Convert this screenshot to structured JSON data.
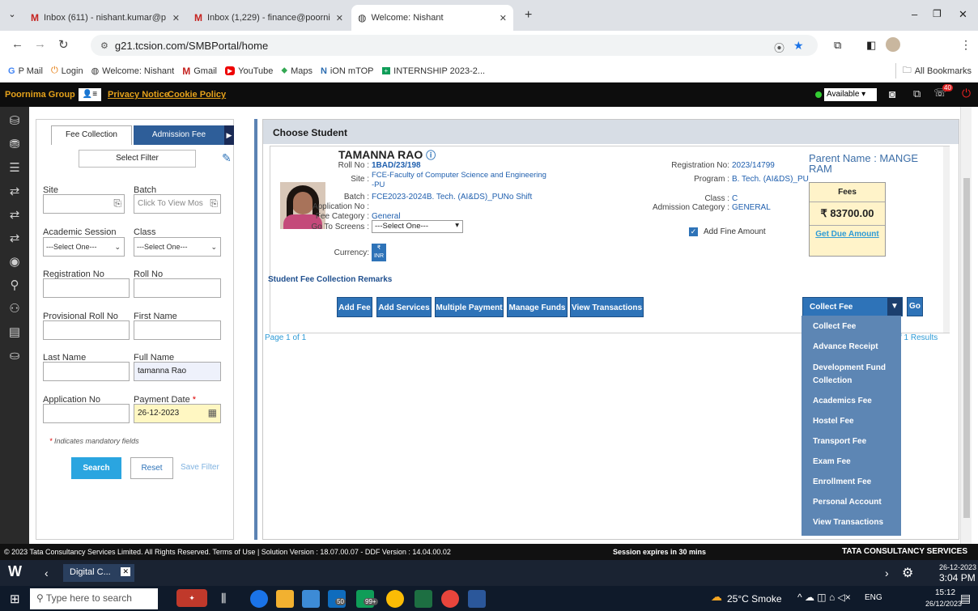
{
  "browser": {
    "tabs": [
      {
        "label": "Inbox (611) - nishant.kumar@p",
        "icon": "gmail-icon"
      },
      {
        "label": "Inbox (1,229) - finance@poorni",
        "icon": "gmail-icon"
      },
      {
        "label": "Welcome: Nishant",
        "icon": "globe-icon"
      }
    ],
    "url": "g21.tcsion.com/SMBPortal/home",
    "bookmarks": [
      "P Mail",
      "Login",
      "Welcome: Nishant",
      "Gmail",
      "YouTube",
      "Maps",
      "iON mTOP",
      "INTERNSHIP 2023-2..."
    ],
    "all_bookmarks": "All Bookmarks"
  },
  "topbar": {
    "org": "Poornima Group",
    "privacy": "Privacy Notice",
    "cookie": "Cookie Policy",
    "status": "Available",
    "badge": "40"
  },
  "filters": {
    "tabs": [
      "Fee Collection",
      "Admission Fee Collection"
    ],
    "select_filter": "Select Filter",
    "site_label": "Site",
    "batch_label": "Batch",
    "batch_placeholder": "Click To View Mos",
    "academic_session_label": "Academic Session",
    "class_label": "Class",
    "select_one": "---Select One---",
    "registration_no_label": "Registration No",
    "roll_no_label": "Roll No",
    "provisional_roll_label": "Provisional Roll No",
    "first_name_label": "First Name",
    "last_name_label": "Last Name",
    "full_name_label": "Full Name",
    "full_name_value": "tamanna Rao",
    "application_no_label": "Application No",
    "payment_date_label": "Payment Date",
    "payment_date_value": "26-12-2023",
    "mandatory_note": "Indicates mandatory fields",
    "search": "Search",
    "reset": "Reset",
    "save_filter": "Save Filter"
  },
  "student": {
    "header": "Choose Student",
    "name": "TAMANNA RAO",
    "roll_label": "Roll No :",
    "roll_value": "1BAD/23/198",
    "site_label": "Site :",
    "site_value_1": "FCE-Faculty of Computer Science and Engineering",
    "site_value_2": "-PU",
    "batch_label": "Batch :",
    "batch_value": "FCE2023-2024B. Tech. (AI&DS)_PUNo Shift",
    "application_label": "Application No :",
    "fee_category_label": "Fee Category :",
    "fee_category_value": "General",
    "goto_label": "Go To Screens :",
    "goto_value": "---Select One---",
    "currency_label": "Currency:",
    "currency_value": "INR",
    "registration_label": "Registration No:",
    "registration_value": "2023/14799",
    "program_label": "Program :",
    "program_value": "B. Tech. (AI&DS)_PU",
    "class_label": "Class :",
    "class_value": "C",
    "admission_cat_label": "Admission Category :",
    "admission_cat_value": "GENERAL",
    "add_fine": "Add Fine Amount",
    "parent_name": "Parent Name : MANGE RAM",
    "fees_label": "Fees",
    "fees_amount": "₹ 83700.00",
    "get_due": "Get Due Amount",
    "remarks": "Student Fee Collection Remarks"
  },
  "actions": [
    "Add Fee",
    "Add Services",
    "Multiple Payment",
    "Manage Funds",
    "View Transactions"
  ],
  "collect": {
    "selected": "Collect Fee",
    "go": "Go"
  },
  "menu": [
    "Collect Fee",
    "Advance Receipt",
    "Development Fund Collection",
    "Academics Fee",
    "Hostel Fee",
    "Transport Fee",
    "Exam Fee",
    "Enrollment Fee",
    "Personal Account",
    "View Transactions"
  ],
  "paging": {
    "page": "Page 1 of 1",
    "results": "f 1 Results"
  },
  "footer": {
    "copyright": "© 2023 Tata Consultancy Services Limited. All Rights Reserved.  Terms of Use | Solution Version : 18.07.00.07 - DDF Version : 14.04.00.02",
    "session": "Session expires in 30 mins",
    "brand": "TATA CONSULTANCY SERVICES"
  },
  "taskbar": {
    "app_title": "Digital C...",
    "date_top": "26-12-2023",
    "time_top": "3:04 PM",
    "search": "Type here to search",
    "weather": "25°C Smoke",
    "lang": "ENG",
    "time": "15:12",
    "date": "26/12/2023",
    "badge": "50",
    "badge2": "99+"
  },
  "colors": {
    "accent": "#2e73b8",
    "menu": "#5d86b4",
    "highlight_input": "#fff7c2"
  }
}
